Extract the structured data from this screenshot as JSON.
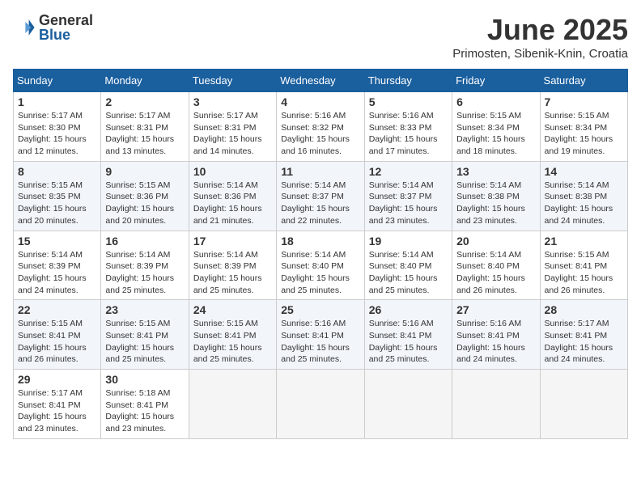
{
  "logo": {
    "general": "General",
    "blue": "Blue"
  },
  "title": "June 2025",
  "location": "Primosten, Sibenik-Knin, Croatia",
  "weekdays": [
    "Sunday",
    "Monday",
    "Tuesday",
    "Wednesday",
    "Thursday",
    "Friday",
    "Saturday"
  ],
  "weeks": [
    [
      {
        "day": "1",
        "sunrise": "5:17 AM",
        "sunset": "8:30 PM",
        "daylight": "15 hours and 12 minutes."
      },
      {
        "day": "2",
        "sunrise": "5:17 AM",
        "sunset": "8:31 PM",
        "daylight": "15 hours and 13 minutes."
      },
      {
        "day": "3",
        "sunrise": "5:17 AM",
        "sunset": "8:31 PM",
        "daylight": "15 hours and 14 minutes."
      },
      {
        "day": "4",
        "sunrise": "5:16 AM",
        "sunset": "8:32 PM",
        "daylight": "15 hours and 16 minutes."
      },
      {
        "day": "5",
        "sunrise": "5:16 AM",
        "sunset": "8:33 PM",
        "daylight": "15 hours and 17 minutes."
      },
      {
        "day": "6",
        "sunrise": "5:15 AM",
        "sunset": "8:34 PM",
        "daylight": "15 hours and 18 minutes."
      },
      {
        "day": "7",
        "sunrise": "5:15 AM",
        "sunset": "8:34 PM",
        "daylight": "15 hours and 19 minutes."
      }
    ],
    [
      {
        "day": "8",
        "sunrise": "5:15 AM",
        "sunset": "8:35 PM",
        "daylight": "15 hours and 20 minutes."
      },
      {
        "day": "9",
        "sunrise": "5:15 AM",
        "sunset": "8:36 PM",
        "daylight": "15 hours and 20 minutes."
      },
      {
        "day": "10",
        "sunrise": "5:14 AM",
        "sunset": "8:36 PM",
        "daylight": "15 hours and 21 minutes."
      },
      {
        "day": "11",
        "sunrise": "5:14 AM",
        "sunset": "8:37 PM",
        "daylight": "15 hours and 22 minutes."
      },
      {
        "day": "12",
        "sunrise": "5:14 AM",
        "sunset": "8:37 PM",
        "daylight": "15 hours and 23 minutes."
      },
      {
        "day": "13",
        "sunrise": "5:14 AM",
        "sunset": "8:38 PM",
        "daylight": "15 hours and 23 minutes."
      },
      {
        "day": "14",
        "sunrise": "5:14 AM",
        "sunset": "8:38 PM",
        "daylight": "15 hours and 24 minutes."
      }
    ],
    [
      {
        "day": "15",
        "sunrise": "5:14 AM",
        "sunset": "8:39 PM",
        "daylight": "15 hours and 24 minutes."
      },
      {
        "day": "16",
        "sunrise": "5:14 AM",
        "sunset": "8:39 PM",
        "daylight": "15 hours and 25 minutes."
      },
      {
        "day": "17",
        "sunrise": "5:14 AM",
        "sunset": "8:39 PM",
        "daylight": "15 hours and 25 minutes."
      },
      {
        "day": "18",
        "sunrise": "5:14 AM",
        "sunset": "8:40 PM",
        "daylight": "15 hours and 25 minutes."
      },
      {
        "day": "19",
        "sunrise": "5:14 AM",
        "sunset": "8:40 PM",
        "daylight": "15 hours and 25 minutes."
      },
      {
        "day": "20",
        "sunrise": "5:14 AM",
        "sunset": "8:40 PM",
        "daylight": "15 hours and 26 minutes."
      },
      {
        "day": "21",
        "sunrise": "5:15 AM",
        "sunset": "8:41 PM",
        "daylight": "15 hours and 26 minutes."
      }
    ],
    [
      {
        "day": "22",
        "sunrise": "5:15 AM",
        "sunset": "8:41 PM",
        "daylight": "15 hours and 26 minutes."
      },
      {
        "day": "23",
        "sunrise": "5:15 AM",
        "sunset": "8:41 PM",
        "daylight": "15 hours and 25 minutes."
      },
      {
        "day": "24",
        "sunrise": "5:15 AM",
        "sunset": "8:41 PM",
        "daylight": "15 hours and 25 minutes."
      },
      {
        "day": "25",
        "sunrise": "5:16 AM",
        "sunset": "8:41 PM",
        "daylight": "15 hours and 25 minutes."
      },
      {
        "day": "26",
        "sunrise": "5:16 AM",
        "sunset": "8:41 PM",
        "daylight": "15 hours and 25 minutes."
      },
      {
        "day": "27",
        "sunrise": "5:16 AM",
        "sunset": "8:41 PM",
        "daylight": "15 hours and 24 minutes."
      },
      {
        "day": "28",
        "sunrise": "5:17 AM",
        "sunset": "8:41 PM",
        "daylight": "15 hours and 24 minutes."
      }
    ],
    [
      {
        "day": "29",
        "sunrise": "5:17 AM",
        "sunset": "8:41 PM",
        "daylight": "15 hours and 23 minutes."
      },
      {
        "day": "30",
        "sunrise": "5:18 AM",
        "sunset": "8:41 PM",
        "daylight": "15 hours and 23 minutes."
      },
      null,
      null,
      null,
      null,
      null
    ]
  ]
}
